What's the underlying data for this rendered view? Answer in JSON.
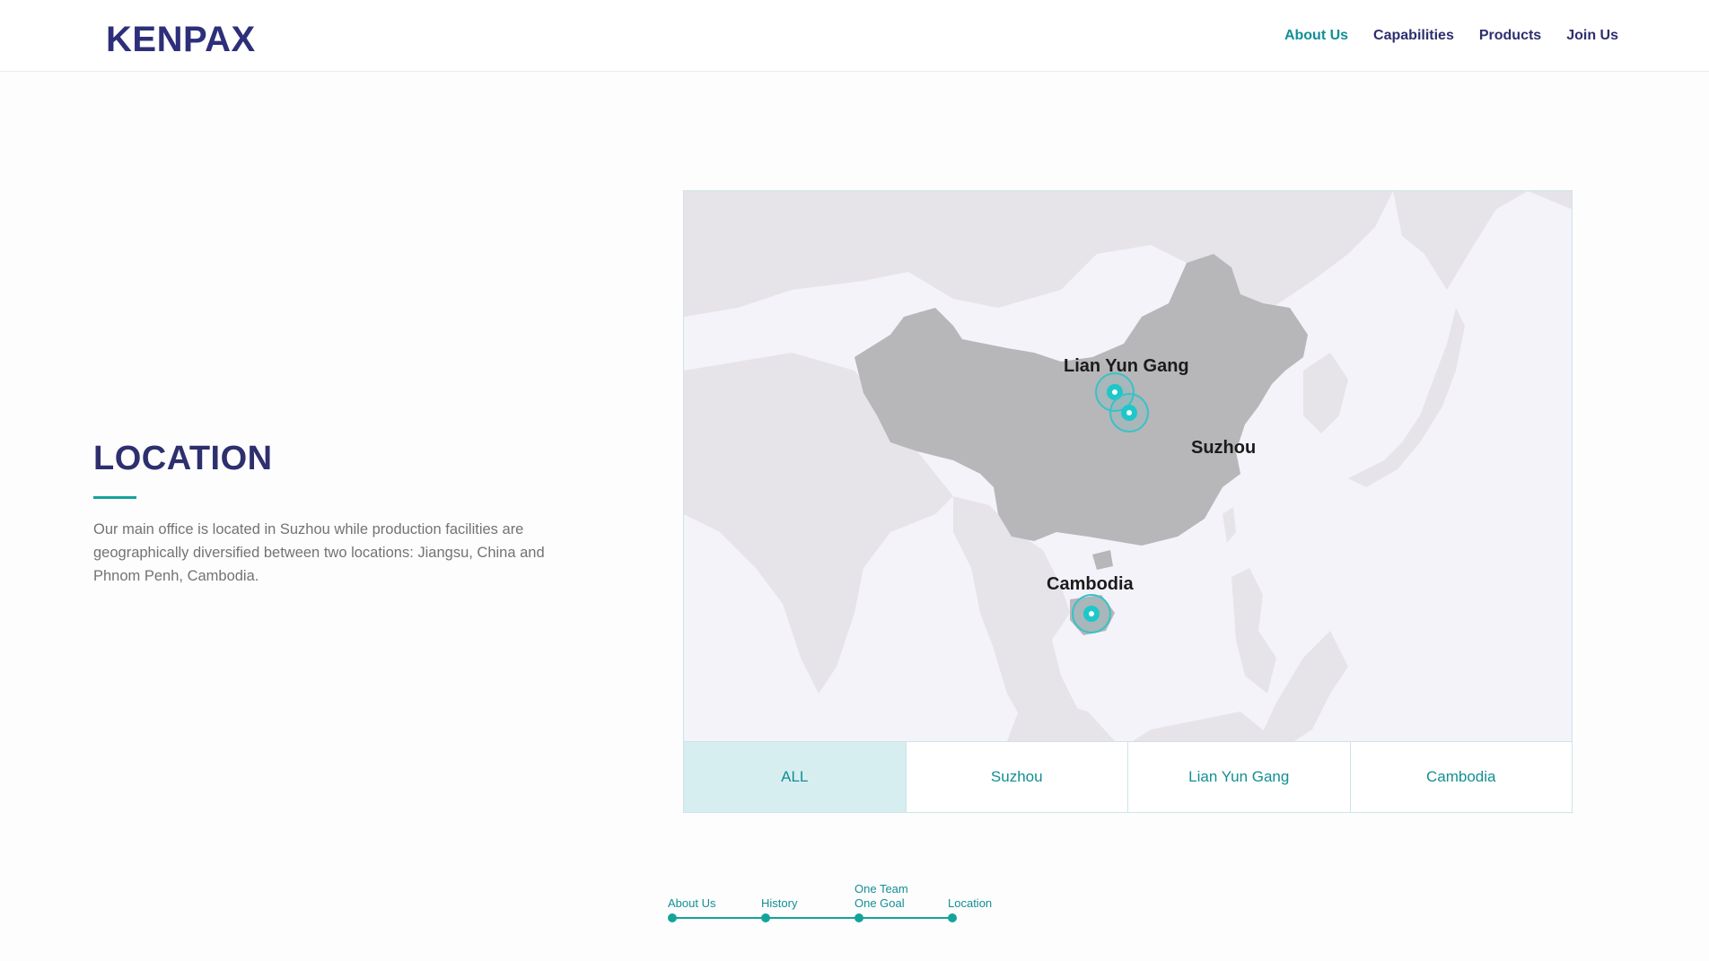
{
  "header": {
    "logo": {
      "part1": "KEN",
      "part2": "PAX"
    },
    "nav": [
      {
        "label": "About Us",
        "active": true
      },
      {
        "label": "Capabilities",
        "active": false
      },
      {
        "label": "Products",
        "active": false
      },
      {
        "label": "Join Us",
        "active": false
      }
    ]
  },
  "section": {
    "title": "LOCATION",
    "description": "Our main office is located in Suzhou while production facilities are geographically diversified between two locations: Jiangsu, China and Phnom Penh, Cambodia."
  },
  "map": {
    "labels": {
      "lianyungang": "Lian Yun Gang",
      "suzhou": "Suzhou",
      "cambodia": "Cambodia"
    }
  },
  "tabs": [
    {
      "label": "ALL",
      "active": true
    },
    {
      "label": "Suzhou",
      "active": false
    },
    {
      "label": "Lian Yun Gang",
      "active": false
    },
    {
      "label": "Cambodia",
      "active": false
    }
  ],
  "progress": [
    {
      "line1": "",
      "line2": "About Us"
    },
    {
      "line1": "",
      "line2": "History"
    },
    {
      "line1": "One Team",
      "line2": "One Goal"
    },
    {
      "line1": "",
      "line2": "Location"
    }
  ],
  "colors": {
    "accent": "#14a39a",
    "navy": "#2d2f6e",
    "map_land": "#b7b6b9",
    "map_neighbor": "#e6e4e8",
    "map_sea": "#f4f3f9"
  },
  "icons": [
    "map-marker-icon"
  ]
}
